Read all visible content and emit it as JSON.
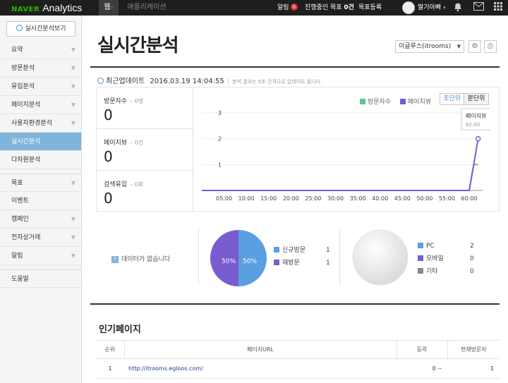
{
  "topbar": {
    "logo_brand": "NAVER",
    "logo_product": "Analytics",
    "tabs": [
      {
        "label": "웹"
      },
      {
        "label": "애플리케이션"
      }
    ],
    "alerts_label": "알림",
    "alerts_count": "0",
    "goals_in_progress_label": "진행중인 목표",
    "goals_in_progress_count": "0건",
    "register_goal_label": "목표등록",
    "username": "딸기아빠",
    "icons": [
      "avatar",
      "bell-icon",
      "mail-icon",
      "apps-grid-icon"
    ]
  },
  "sidebar": {
    "realtime_button": "실시간분석보기",
    "items": [
      {
        "label": "요약",
        "chevron": true
      },
      {
        "label": "방문분석",
        "chevron": true
      },
      {
        "label": "유입분석",
        "chevron": true
      },
      {
        "label": "페이지분석",
        "chevron": true
      },
      {
        "label": "사용자환경분석",
        "chevron": true
      },
      {
        "label": "실시간분석",
        "chevron": false,
        "active": true
      },
      {
        "label": "다차원분석",
        "chevron": false
      },
      {
        "label": "목표",
        "chevron": true
      },
      {
        "label": "이벤트",
        "chevron": false
      },
      {
        "label": "캠페인",
        "chevron": true
      },
      {
        "label": "전자상거래",
        "chevron": true
      },
      {
        "label": "알림",
        "chevron": true
      },
      {
        "label": "도움말",
        "chevron": false
      }
    ],
    "accent": "#7fb5db"
  },
  "main": {
    "title": "실시간분석",
    "site_select": "이글루스(itrooms)",
    "update_label": "최근업데이트",
    "update_time": "2016.03.19 14:04:55",
    "update_note": "분석 결과는 5초 간격으로 업데이트 됩니다.",
    "stats": [
      {
        "label": "방문자수",
        "delta": "0명",
        "value": "0"
      },
      {
        "label": "페이지뷰",
        "delta": "0건",
        "value": "0"
      },
      {
        "label": "검색유입",
        "delta": "0회",
        "value": "0"
      }
    ],
    "legend": [
      {
        "label": "방문자수",
        "color": "#5cc68a"
      },
      {
        "label": "페이지뷰",
        "color": "#7a5cd1"
      }
    ],
    "unit_buttons": {
      "sec": "초단위",
      "min": "분단위",
      "selected": "min"
    },
    "tooltip": {
      "series": "페이지뷰",
      "value": "2",
      "time": "62:00"
    },
    "nodata_text": "데이터가 없습니다",
    "visit_pie": {
      "left_pct_label": "50%",
      "right_pct_label": "50%",
      "legend": [
        {
          "label": "신규방문",
          "value": "1",
          "color": "#5a9fe0"
        },
        {
          "label": "재방문",
          "value": "1",
          "color": "#7a5cd1"
        }
      ]
    },
    "device_pie": {
      "legend": [
        {
          "label": "PC",
          "value": "2",
          "color": "#5a9fe0"
        },
        {
          "label": "모바일",
          "value": "0",
          "color": "#7a5cd1"
        },
        {
          "label": "기타",
          "value": "0",
          "color": "#888888"
        }
      ]
    },
    "popular_pages": {
      "title": "인기페이지",
      "columns": [
        "순위",
        "페이지URL",
        "등락",
        "현재방문자"
      ],
      "rows": [
        {
          "rank": "1",
          "url": "http://itrooms.egloos.com/",
          "change": "0 --",
          "visitors": "1"
        }
      ]
    }
  },
  "chart_data": {
    "type": "line",
    "x_ticks": [
      "05:00",
      "10:00",
      "15:00",
      "20:00",
      "25:00",
      "30:00",
      "35:00",
      "40:00",
      "45:00",
      "50:00",
      "55:00",
      "60:00"
    ],
    "ylim": [
      0,
      3
    ],
    "y_ticks": [
      "1",
      "2",
      "3"
    ],
    "series": [
      {
        "name": "방문자수",
        "color": "#5cc68a",
        "points": [
          [
            0,
            0
          ],
          [
            60,
            0
          ],
          [
            61,
            1
          ],
          [
            62,
            1
          ]
        ]
      },
      {
        "name": "페이지뷰",
        "color": "#7a5cd1",
        "points": [
          [
            0,
            0
          ],
          [
            60,
            0
          ],
          [
            61,
            1
          ],
          [
            62,
            2
          ]
        ]
      }
    ]
  }
}
